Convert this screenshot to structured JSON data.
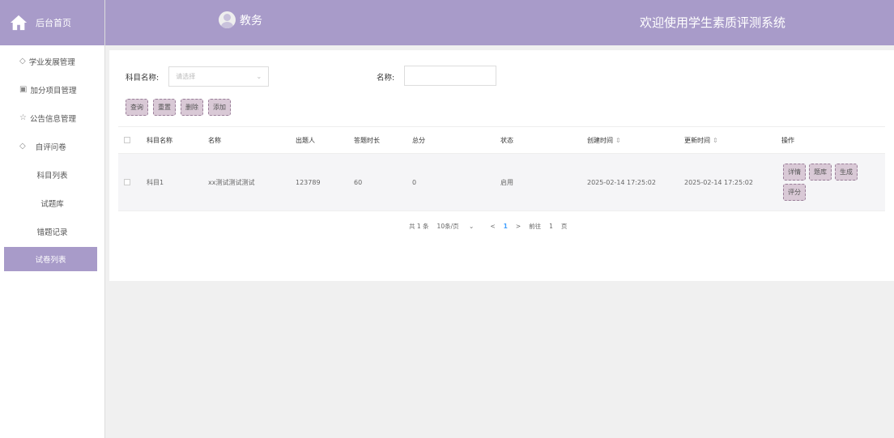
{
  "sidebar": {
    "home_label": "后台首页",
    "items": [
      {
        "label": "学业发展管理",
        "icon": "shield-icon"
      },
      {
        "label": "加分项目管理",
        "icon": "gift-icon"
      },
      {
        "label": "公告信息管理",
        "icon": "star-icon"
      },
      {
        "label": "自评问卷",
        "icon": "shield-icon"
      }
    ],
    "sub_items": [
      {
        "label": "科目列表"
      },
      {
        "label": "试题库"
      },
      {
        "label": "错题记录"
      },
      {
        "label": "试卷列表",
        "active": true
      }
    ]
  },
  "header": {
    "role": "教务",
    "system_title": "欢迎使用学生素质评测系统"
  },
  "filter": {
    "subject_label": "科目名称:",
    "subject_placeholder": "请选择",
    "name_label": "名称:",
    "name_value": ""
  },
  "toolbar": {
    "query": "查询",
    "reset": "重置",
    "delete": "删除",
    "add": "添加"
  },
  "table": {
    "headers": [
      "科目名称",
      "名称",
      "出题人",
      "答题时长",
      "总分",
      "状态",
      "创建时间",
      "更新时间",
      "操作"
    ],
    "rows": [
      {
        "subject": "科目1",
        "name": "xx测试测试测试",
        "author": "123789",
        "duration": "60",
        "total": "0",
        "status": "启用",
        "created": "2025-02-14 17:25:02",
        "updated": "2025-02-14 17:25:02",
        "actions": [
          "详情",
          "题库",
          "生成",
          "评分"
        ]
      }
    ]
  },
  "pagination": {
    "total": "共 1 条",
    "page_size": "10条/页",
    "prev": "<",
    "current": "1",
    "next": ">",
    "goto_label": "前往",
    "goto_value": "1",
    "page_suffix": "页"
  },
  "colors": {
    "primary": "#a89bc9",
    "button_bg": "#d9c9d6",
    "accent": "#409eff"
  }
}
